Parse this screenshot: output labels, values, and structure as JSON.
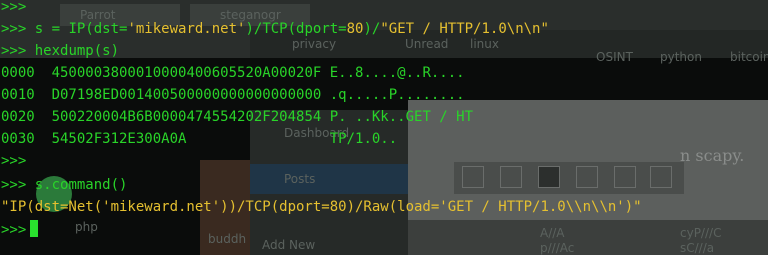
{
  "background": {
    "tabs": [
      "Parrot",
      "steganogr"
    ],
    "bookmarks": [
      "privacy",
      "Unread",
      "linux",
      "OSINT",
      "python",
      "bitcoin"
    ],
    "sidebar_items": [
      "Dashboard",
      "Posts",
      "Add New"
    ],
    "panel_text": "n scapy.",
    "left_labels": [
      "php",
      "buddh"
    ],
    "editor_lines": [
      "A//A",
      "cyP///C",
      "p///Ac",
      "sC///a"
    ]
  },
  "terminal": {
    "prompt": ">>>",
    "cmd_packet": {
      "before_dst": " s = IP(dst=",
      "dst": "'mikeward.net'",
      "after_dst": ")/TCP(dport=",
      "dport": "80",
      "after_dport": ")/",
      "payload": "\"GET / HTTP/1.0\\n\\n\""
    },
    "cmd_hexdump": " hexdump(s)",
    "hexdump_rows": [
      {
        "offset": "0000",
        "hex": "4500003800010000400605520A00020F",
        "ascii": "E..8....@..R...."
      },
      {
        "offset": "0010",
        "hex": "D07198ED001400500000000000000000",
        "ascii": ".q.....P........"
      },
      {
        "offset": "0020",
        "hex": "500220004B6B0000474554202F204854",
        "ascii": "P. ..Kk..GET / HT"
      },
      {
        "offset": "0030",
        "hex": "54502F312E300A0A",
        "ascii": "TP/1.0.."
      }
    ],
    "cmd_command": " s.command()",
    "command_output": "\"IP(dst=Net('mikeward.net'))/TCP(dport=80)/Raw(load='GET / HTTP/1.0\\\\n\\\\n')\""
  },
  "colors": {
    "terminal_green": "#29d429",
    "string_yellow": "#e5c030",
    "cursor": "#29e02e"
  }
}
